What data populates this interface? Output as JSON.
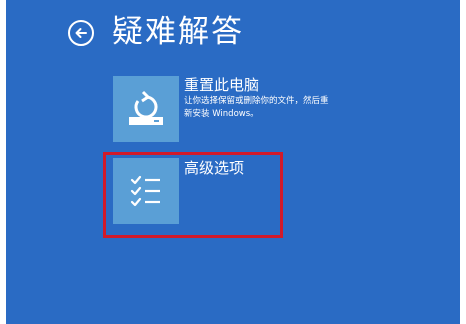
{
  "header": {
    "title": "疑难解答",
    "back_icon": "back-arrow-icon"
  },
  "options": [
    {
      "label": "重置此电脑",
      "description": "让你选择保留或删除你的文件，然后重新安装 Windows。",
      "icon": "reset-pc-icon"
    },
    {
      "label": "高级选项",
      "icon": "checklist-icon"
    }
  ],
  "colors": {
    "background": "#2a6bc4",
    "tile": "#5a9fd6",
    "highlight": "#d11a2a",
    "text": "#ffffff"
  }
}
